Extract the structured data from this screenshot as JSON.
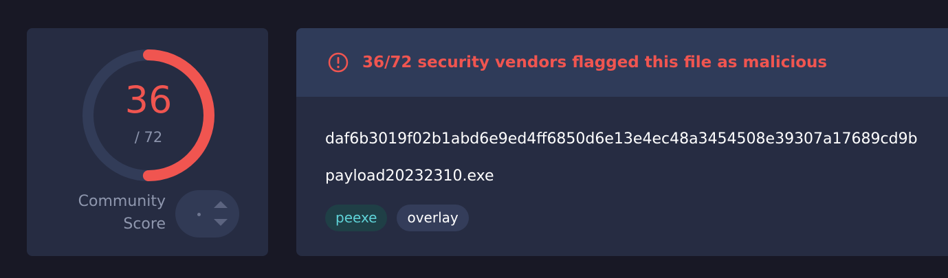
{
  "score": {
    "detections": "36",
    "total": "/ 72",
    "detection_fraction": 0.5,
    "community_label_line1": "Community",
    "community_label_line2": "Score",
    "colors": {
      "accent": "#f05550",
      "track": "#323c58"
    }
  },
  "alert": {
    "icon": "exclamation-circle-icon",
    "text": "36/72 security vendors flagged this file as malicious"
  },
  "file": {
    "hash": "daf6b3019f02b1abd6e9ed4ff6850d6e13e4ec48a3454508e39307a17689cd9b",
    "name": "payload20232310.exe",
    "tags": [
      "peexe",
      "overlay"
    ]
  }
}
